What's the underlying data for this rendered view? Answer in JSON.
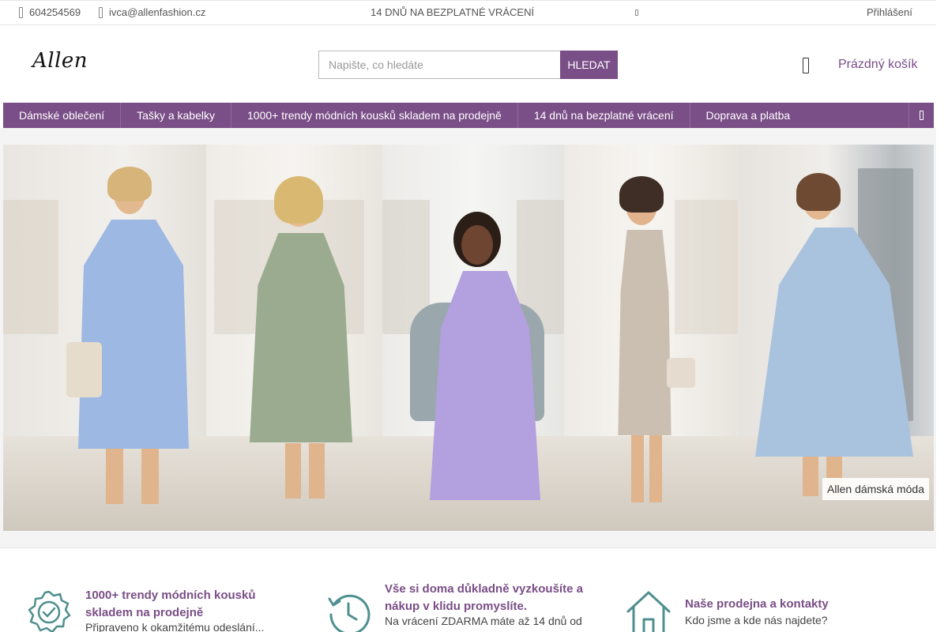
{
  "topbar": {
    "phone": "604254569",
    "email": "ivca@allenfashion.cz",
    "promo": "14 DNŮ NA BEZPLATNÉ VRÁCENÍ",
    "login": "Přihlášení"
  },
  "header": {
    "logo": "Allen",
    "search_placeholder": "Napište, co hledáte",
    "search_button": "HLEDAT",
    "cart_label": "Prázdný košík"
  },
  "nav": {
    "items": [
      {
        "label": "Dámské oblečení"
      },
      {
        "label": "Tašky a kabelky"
      },
      {
        "label": "1000+ trendy módních kousků skladem na prodejně"
      },
      {
        "label": "14 dnů na bezplatné vrácení"
      },
      {
        "label": "Doprava a platba"
      }
    ]
  },
  "hero": {
    "caption": "Allen dámská móda"
  },
  "features": [
    {
      "title": "1000+ trendy módních kousků skladem na prodejně",
      "text": "Připraveno k okamžitému odeslání..."
    },
    {
      "title": "Vše si doma důkladně vyzkoušíte a nákup v klidu promyslíte.",
      "text": "Na vrácení ZDARMA máte až 14 dnů od"
    },
    {
      "title": "Naše prodejna a kontakty",
      "text": "Kdo jsme a kde nás najdete?"
    }
  ],
  "colors": {
    "brand": "#7a4e87",
    "icon_teal": "#4f8f8f"
  }
}
